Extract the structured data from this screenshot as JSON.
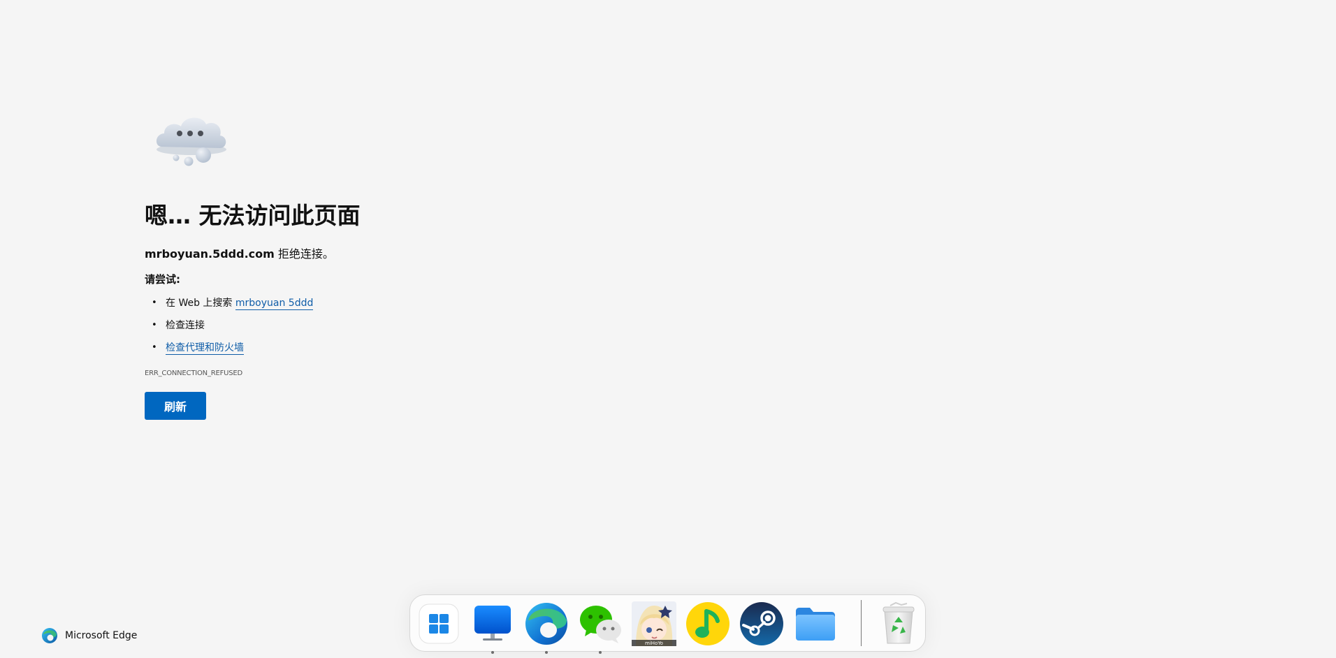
{
  "error_page": {
    "title": "嗯… 无法访问此页面",
    "host": "mrboyuan.5ddd.com",
    "message_suffix": " 拒绝连接。",
    "try_heading": "请尝试:",
    "suggestions": {
      "search_prefix": "在 Web 上搜索 ",
      "search_link": "mrboyuan 5ddd",
      "check_connection": "检查连接",
      "check_proxy_link": "检查代理和防火墙"
    },
    "error_code": "ERR_CONNECTION_REFUSED",
    "refresh_label": "刷新"
  },
  "branding": {
    "browser_name": "Microsoft Edge"
  },
  "taskbar": {
    "apps": [
      {
        "icon": "start-menu-icon",
        "running": false
      },
      {
        "icon": "desktop-monitor-icon",
        "running": true
      },
      {
        "icon": "edge-browser-icon",
        "running": true
      },
      {
        "icon": "wechat-icon",
        "running": true
      },
      {
        "icon": "miyoushe-avatar-icon",
        "running": false,
        "caption": "miHoYo"
      },
      {
        "icon": "qq-music-icon",
        "running": false
      },
      {
        "icon": "steam-icon",
        "running": false
      },
      {
        "icon": "file-explorer-folder-icon",
        "running": false
      },
      {
        "icon": "recycle-bin-icon",
        "running": false
      }
    ]
  },
  "colors": {
    "background": "#f5f5f5",
    "accent": "#0067c0",
    "link": "#0f5da8"
  }
}
